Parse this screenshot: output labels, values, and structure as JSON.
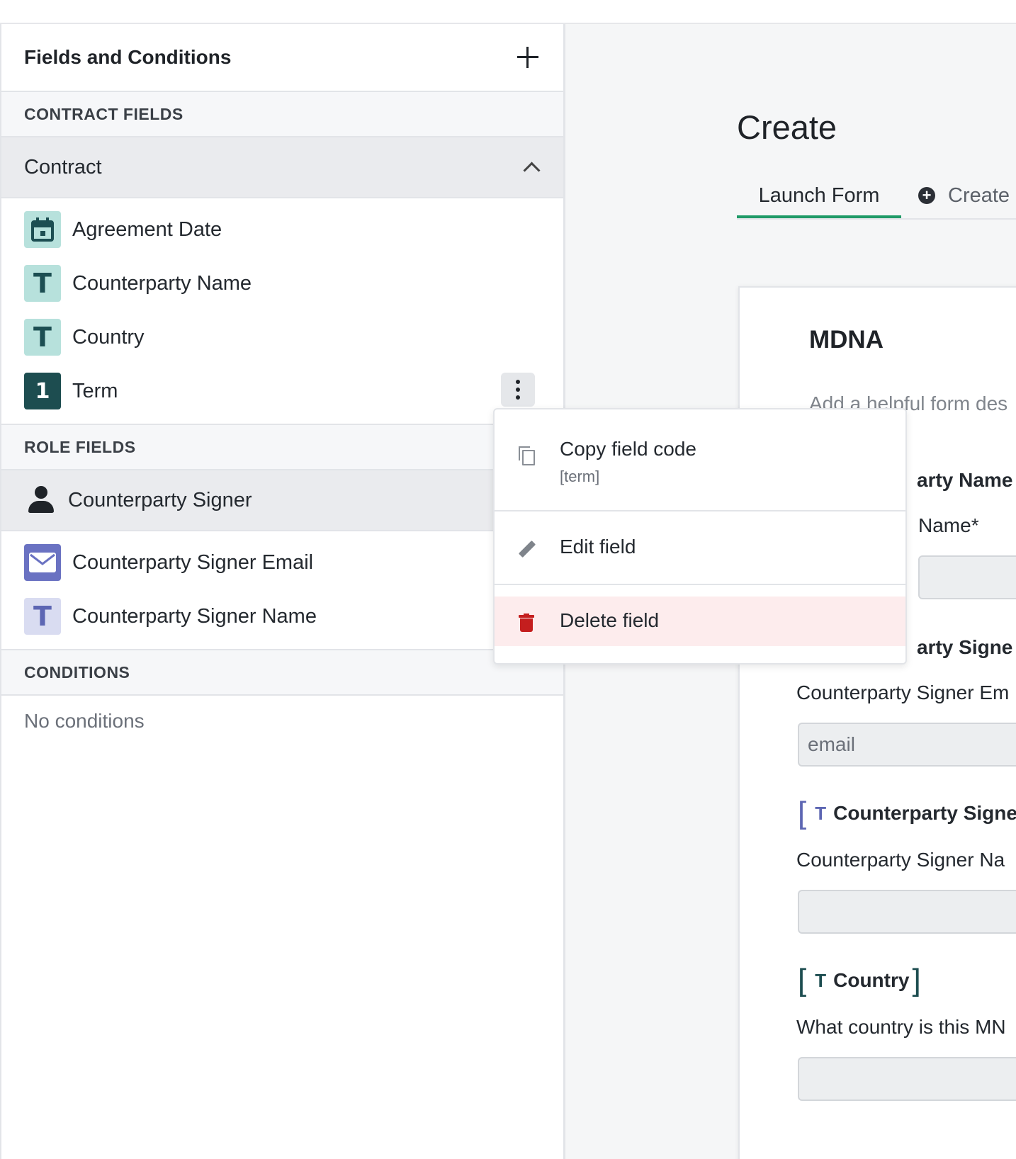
{
  "left_panel": {
    "title": "Fields and Conditions",
    "sections": {
      "contract": "CONTRACT FIELDS",
      "role": "ROLE FIELDS",
      "conditions": "CONDITIONS"
    },
    "contract_group": "Contract",
    "contract_fields": [
      {
        "label": "Agreement Date",
        "icon": "calendar-icon"
      },
      {
        "label": "Counterparty Name",
        "icon": "text-icon",
        "glyph": "T"
      },
      {
        "label": "Country",
        "icon": "text-icon",
        "glyph": "T"
      },
      {
        "label": "Term",
        "icon": "number-icon",
        "glyph": "1"
      }
    ],
    "role_group": "Counterparty Signer",
    "role_fields": [
      {
        "label": "Counterparty Signer Email",
        "icon": "email-icon"
      },
      {
        "label": "Counterparty Signer Name",
        "icon": "text-icon",
        "glyph": "T"
      }
    ],
    "no_conditions": "No conditions"
  },
  "main": {
    "title": "Create",
    "tabs": [
      {
        "label": "Launch Form",
        "active": true
      },
      {
        "label": "Create",
        "active": false
      }
    ],
    "form": {
      "name": "MDNA",
      "description_placeholder": "Add a helpful form des",
      "fragments": {
        "counterparty_name_heading": "arty Name",
        "counterparty_name_label": "Name*",
        "signer_heading": "arty Signe",
        "signer_email_label": "Counterparty Signer Em",
        "email_placeholder": "email",
        "signer_name_tag": "Counterparty Signe",
        "signer_name_label": "Counterparty Signer Na",
        "country_tag": "Country",
        "country_question": "What country is this MN"
      },
      "tag_glyph": "T"
    }
  },
  "context_menu": {
    "items": [
      {
        "label": "Copy field code",
        "sublabel": "[term]"
      },
      {
        "label": "Edit field"
      },
      {
        "label": "Delete field"
      }
    ]
  },
  "colors": {
    "teal_icon_bg": "#b7e1dc",
    "number_icon_bg": "#1d4d50",
    "purple_icon_bg": "#d9dcf1",
    "tab_active": "#1f9a67",
    "delete_red": "#c41e1e",
    "delete_bg": "#fdeced"
  }
}
